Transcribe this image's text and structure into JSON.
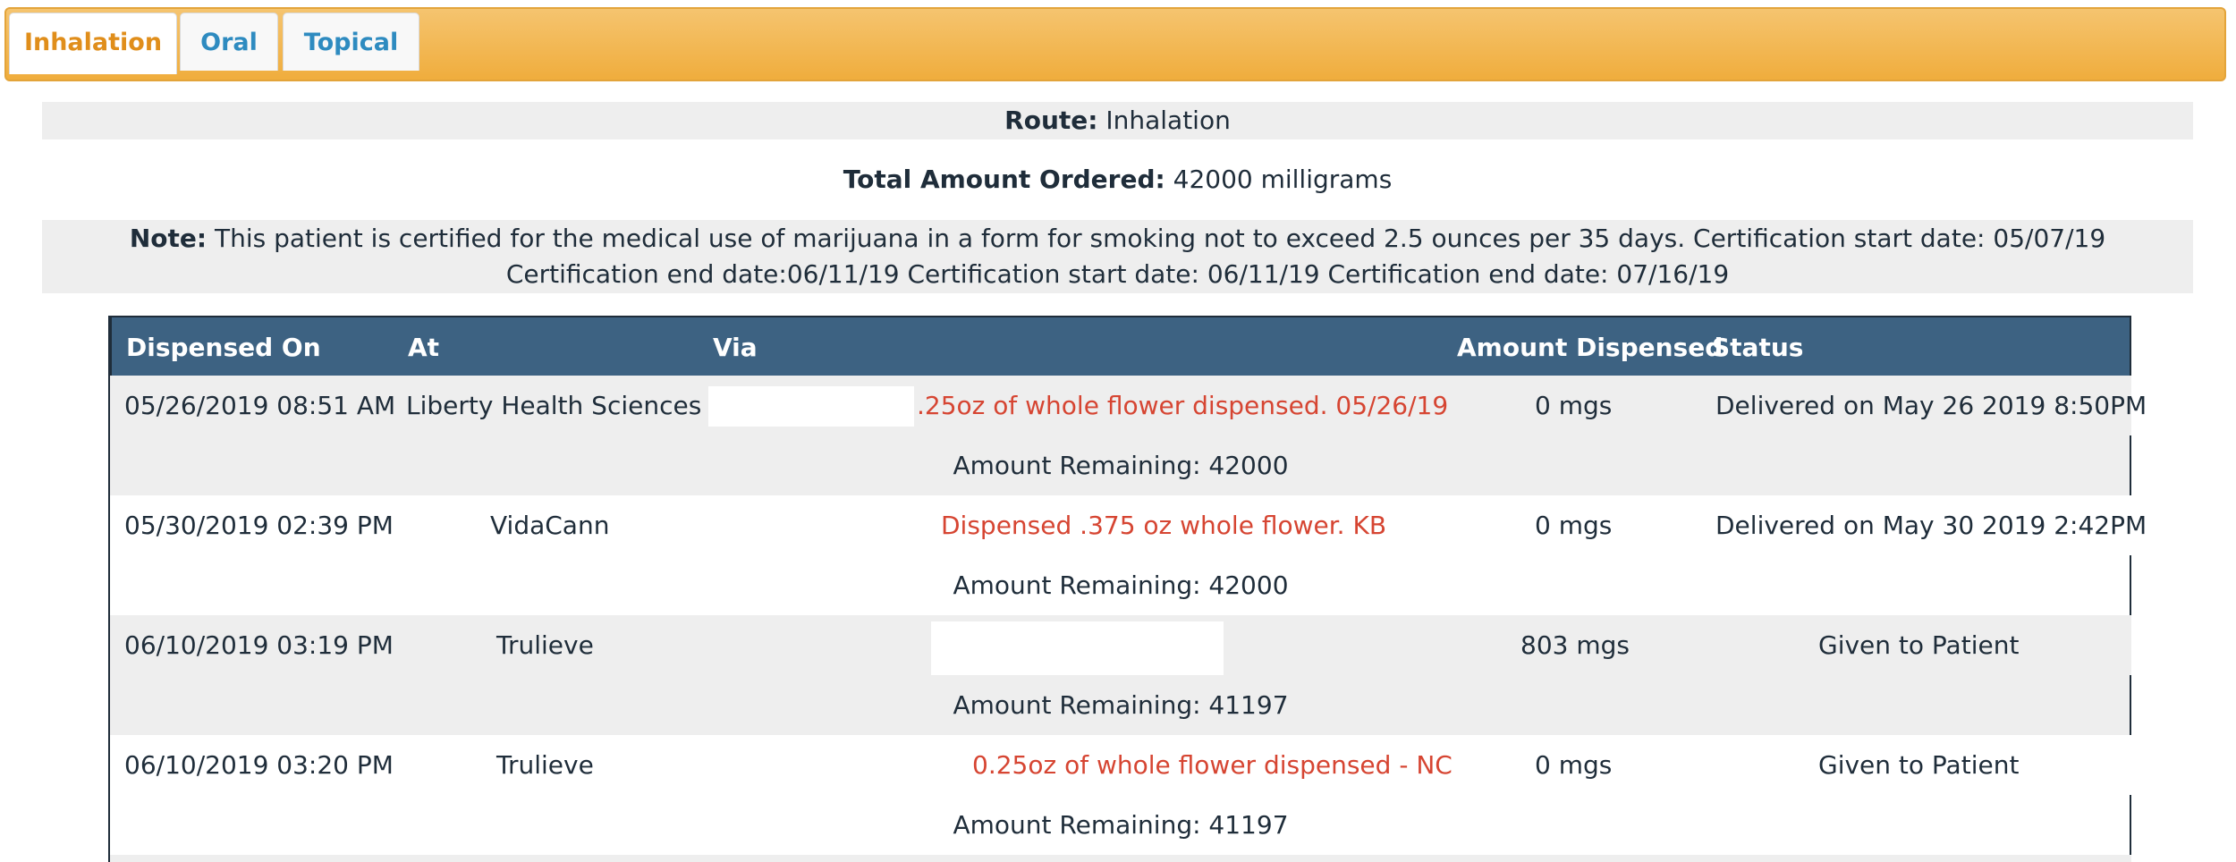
{
  "tabs": [
    {
      "label": "Inhalation",
      "active": true
    },
    {
      "label": "Oral",
      "active": false
    },
    {
      "label": "Topical",
      "active": false
    }
  ],
  "route": {
    "label": "Route:",
    "value": "Inhalation"
  },
  "total": {
    "label": "Total Amount Ordered:",
    "value": "42000 milligrams"
  },
  "note": {
    "label": "Note:",
    "text": "This patient is certified for the medical use of marijuana in a form for smoking not to exceed 2.5 ounces per 35 days. Certification start date: 05/07/19 Certification end date:06/11/19 Certification start date: 06/11/19 Certification end date: 07/16/19"
  },
  "table": {
    "headers": [
      "Dispensed On",
      "At",
      "Via",
      "Amount Dispensed",
      "Status"
    ],
    "rows": [
      {
        "dispensed_on": "05/26/2019 08:51 AM",
        "at": "Liberty Health Sciences",
        "via": ".25oz of whole flower dispensed. 05/26/19",
        "amount": "0 mgs",
        "status": "Delivered on May 26 2019 8:50PM",
        "remaining": "Amount Remaining: 42000"
      },
      {
        "dispensed_on": "05/30/2019 02:39 PM",
        "at": "VidaCann",
        "via": "Dispensed .375 oz whole flower. KB",
        "amount": "0 mgs",
        "status": "Delivered on May 30 2019 2:42PM",
        "remaining": "Amount Remaining: 42000"
      },
      {
        "dispensed_on": "06/10/2019 03:19 PM",
        "at": "Trulieve",
        "via": "",
        "amount": "803 mgs",
        "status": "Given to Patient",
        "remaining": "Amount Remaining: 41197"
      },
      {
        "dispensed_on": "06/10/2019 03:20 PM",
        "at": "Trulieve",
        "via": "0.25oz of whole flower dispensed - NC",
        "amount": "0 mgs",
        "status": "Given to Patient",
        "remaining": "Amount Remaining: 41197"
      }
    ]
  },
  "colors": {
    "tab_bar": "#f0ad3d",
    "header_bg": "#3d6282",
    "via_text": "#d64532",
    "active_tab": "#e08e1b",
    "tab_link": "#2e8bc0"
  }
}
